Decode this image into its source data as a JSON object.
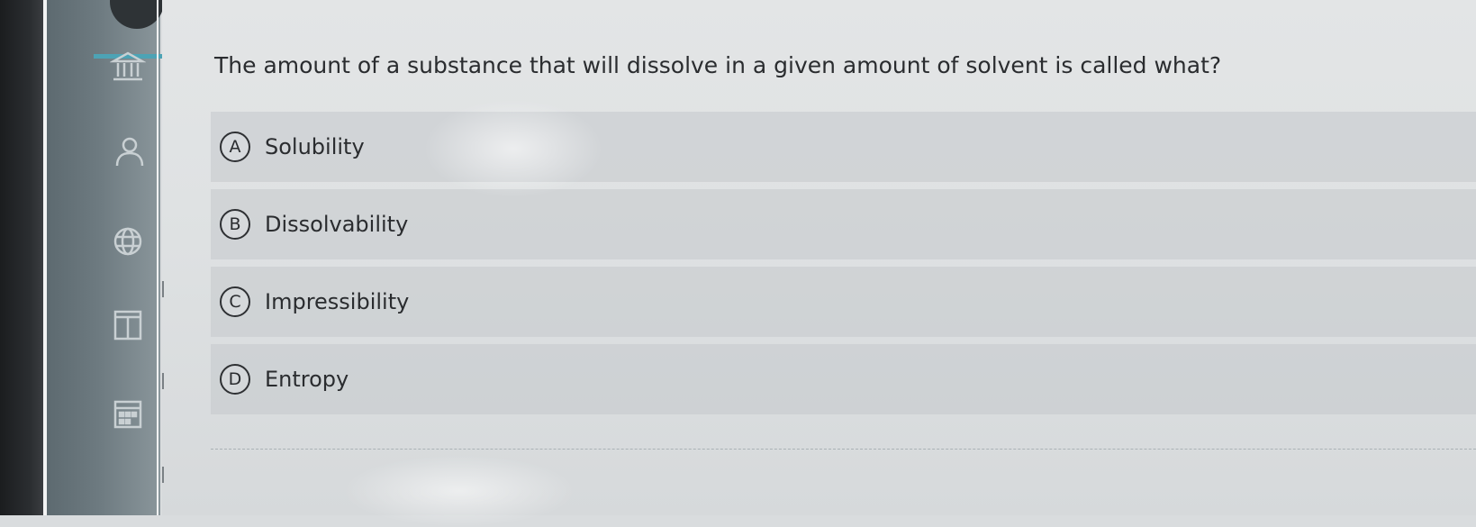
{
  "nav": {
    "icons": [
      "bank-icon",
      "person-icon",
      "globe-icon",
      "book-icon",
      "calendar-icon"
    ]
  },
  "question": {
    "text": "The amount of a substance that will dissolve in a given amount of solvent is called what?"
  },
  "options": [
    {
      "letter": "A",
      "label": "Solubility"
    },
    {
      "letter": "B",
      "label": "Dissolvability"
    },
    {
      "letter": "C",
      "label": "Impressibility"
    },
    {
      "letter": "D",
      "label": "Entropy"
    }
  ]
}
